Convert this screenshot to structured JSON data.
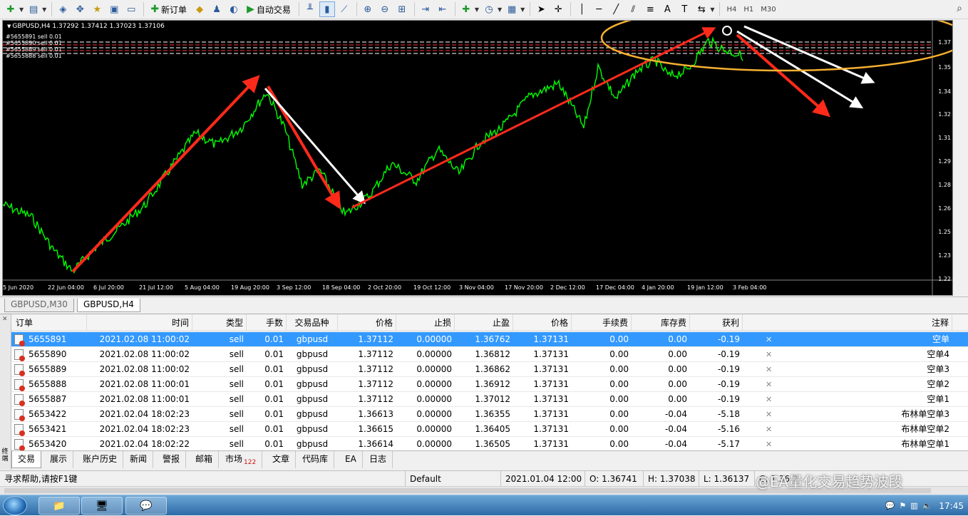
{
  "toolbar": {
    "new_order_label": "新订单",
    "auto_trade_label": "自动交易",
    "timeframes": [
      "H4",
      "H1",
      "M30"
    ]
  },
  "chart": {
    "symbol_line": "GBPUSD,H4  1.37292 1.37412 1.37023 1.37106",
    "order_label_lines": [
      "#5655891 sell 0.01",
      "#5655890 sell 0.01",
      "#5655889 sell 0.01",
      "#5655888 sell 0.01"
    ],
    "price_scale": [
      "1.37",
      "1.35",
      "1.34",
      "1.32",
      "1.31",
      "1.29",
      "1.28",
      "1.26",
      "1.25",
      "1.23",
      "1.22"
    ],
    "time_scale": [
      "5 Jun 2020",
      "22 Jun 04:00",
      "6 Jul 20:00",
      "21 Jul 12:00",
      "5 Aug 04:00",
      "19 Aug 20:00",
      "3 Sep 12:00",
      "18 Sep 04:00",
      "2 Oct 20:00",
      "19 Oct 12:00",
      "3 Nov 04:00",
      "17 Nov 20:00",
      "2 Dec 12:00",
      "17 Dec 04:00",
      "4 Jan 20:00",
      "19 Jan 12:00",
      "3 Feb 04:00"
    ],
    "colors": {
      "background": "#000000",
      "price_line": "#00ff00",
      "arrow_red": "#ff2a1a",
      "arrow_white": "#ffffff",
      "ellipse": "#f5b030"
    }
  },
  "chart_tabs": [
    "GBPUSD,M30",
    "GBPUSD,H4"
  ],
  "terminal": {
    "side_label": "终端",
    "columns": [
      "订单",
      "时间",
      "类型",
      "手数",
      "交易品种",
      "价格",
      "止损",
      "止盈",
      "价格",
      "手续费",
      "库存费",
      "获利",
      "注释"
    ],
    "rows": [
      {
        "order": "5655891",
        "time": "2021.02.08 11:00:02",
        "type": "sell",
        "lots": "0.01",
        "symbol": "gbpusd",
        "price": "1.37112",
        "sl": "0.00000",
        "tp": "1.36762",
        "cur": "1.37131",
        "fee": "0.00",
        "swap": "0.00",
        "profit": "-0.19",
        "comment": "空单"
      },
      {
        "order": "5655890",
        "time": "2021.02.08 11:00:02",
        "type": "sell",
        "lots": "0.01",
        "symbol": "gbpusd",
        "price": "1.37112",
        "sl": "0.00000",
        "tp": "1.36812",
        "cur": "1.37131",
        "fee": "0.00",
        "swap": "0.00",
        "profit": "-0.19",
        "comment": "空单4"
      },
      {
        "order": "5655889",
        "time": "2021.02.08 11:00:02",
        "type": "sell",
        "lots": "0.01",
        "symbol": "gbpusd",
        "price": "1.37112",
        "sl": "0.00000",
        "tp": "1.36862",
        "cur": "1.37131",
        "fee": "0.00",
        "swap": "0.00",
        "profit": "-0.19",
        "comment": "空单3"
      },
      {
        "order": "5655888",
        "time": "2021.02.08 11:00:01",
        "type": "sell",
        "lots": "0.01",
        "symbol": "gbpusd",
        "price": "1.37112",
        "sl": "0.00000",
        "tp": "1.36912",
        "cur": "1.37131",
        "fee": "0.00",
        "swap": "0.00",
        "profit": "-0.19",
        "comment": "空单2"
      },
      {
        "order": "5655887",
        "time": "2021.02.08 11:00:01",
        "type": "sell",
        "lots": "0.01",
        "symbol": "gbpusd",
        "price": "1.37112",
        "sl": "0.00000",
        "tp": "1.37012",
        "cur": "1.37131",
        "fee": "0.00",
        "swap": "0.00",
        "profit": "-0.19",
        "comment": "空单1"
      },
      {
        "order": "5653422",
        "time": "2021.02.04 18:02:23",
        "type": "sell",
        "lots": "0.01",
        "symbol": "gbpusd",
        "price": "1.36613",
        "sl": "0.00000",
        "tp": "1.36355",
        "cur": "1.37131",
        "fee": "0.00",
        "swap": "-0.04",
        "profit": "-5.18",
        "comment": "布林单空单3"
      },
      {
        "order": "5653421",
        "time": "2021.02.04 18:02:23",
        "type": "sell",
        "lots": "0.01",
        "symbol": "gbpusd",
        "price": "1.36615",
        "sl": "0.00000",
        "tp": "1.36405",
        "cur": "1.37131",
        "fee": "0.00",
        "swap": "-0.04",
        "profit": "-5.16",
        "comment": "布林单空单2"
      },
      {
        "order": "5653420",
        "time": "2021.02.04 18:02:22",
        "type": "sell",
        "lots": "0.01",
        "symbol": "gbpusd",
        "price": "1.36614",
        "sl": "0.00000",
        "tp": "1.36505",
        "cur": "1.37131",
        "fee": "0.00",
        "swap": "-0.04",
        "profit": "-5.17",
        "comment": "布林单空单1"
      }
    ],
    "tabs": [
      {
        "label": "交易"
      },
      {
        "label": "展示"
      },
      {
        "label": "账户历史"
      },
      {
        "label": "新闻"
      },
      {
        "label": "警报"
      },
      {
        "label": "邮箱"
      },
      {
        "label": "市场",
        "badge": "122"
      },
      {
        "label": "文章"
      },
      {
        "label": "代码库"
      },
      {
        "label": "EA"
      },
      {
        "label": "日志"
      }
    ]
  },
  "status": {
    "help": "寻求帮助,请按F1键",
    "profile": "Default",
    "bar_time": "2021.01.04 12:00",
    "open": "O: 1.36741",
    "high": "H: 1.37038",
    "low": "L: 1.36137",
    "extra": "C: 1.36 2"
  },
  "watermark": "@EA量化交易趋势波段",
  "taskbar": {
    "clock_time": "17:45"
  }
}
